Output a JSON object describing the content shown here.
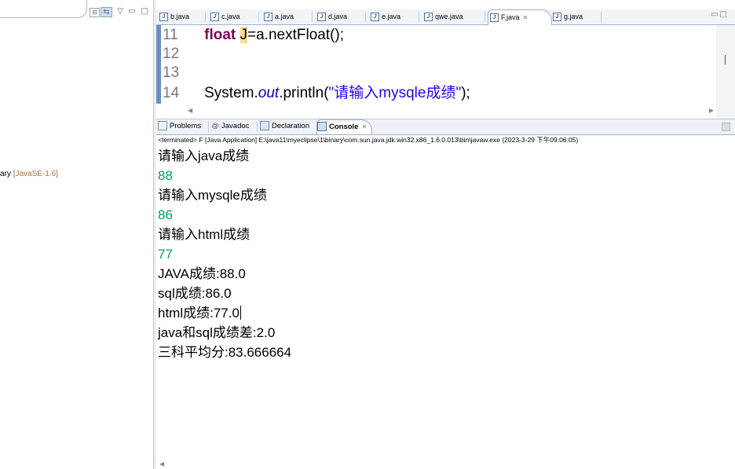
{
  "explorer": {
    "item_text": "ary",
    "item_jre": "[JavaSE-1.6]",
    "toolbar": [
      "collapse-all",
      "link-with-editor",
      "view-menu",
      "minimize",
      "maximize"
    ]
  },
  "editor": {
    "tabs": [
      {
        "label": "b.java"
      },
      {
        "label": "c.java"
      },
      {
        "label": "a.java"
      },
      {
        "label": "d.java"
      },
      {
        "label": "e.java"
      },
      {
        "label": "qwe.java"
      },
      {
        "label": "F.java",
        "active": true
      },
      {
        "label": "g.java"
      }
    ],
    "lines": [
      {
        "num": "11",
        "kw": "float",
        "var": "J",
        "rest": "=a.nextFloat();"
      },
      {
        "num": "12"
      },
      {
        "num": "13"
      },
      {
        "num": "14",
        "prefix": "System.",
        "field": "out",
        "method": ".println(",
        "string": "\"请输入mysqle成绩\"",
        "suffix": ");"
      }
    ]
  },
  "console": {
    "tabs": [
      {
        "label": "Problems",
        "icon": "problems-icon"
      },
      {
        "label": "Javadoc",
        "icon": "at-icon"
      },
      {
        "label": "Declaration",
        "icon": "declaration-icon"
      },
      {
        "label": "Console",
        "icon": "console-icon",
        "active": true
      }
    ],
    "status": "<terminated> F [Java Application] E:\\java11\\myeclipse\\1\\binary\\com.sun.java.jdk.win32.x86_1.6.0.013\\bin\\javaw.exe (2023-3-29 下午09:06:05)",
    "output": [
      {
        "text": "请输入java成绩",
        "type": "out"
      },
      {
        "text": "88",
        "type": "in"
      },
      {
        "text": "请输入mysqle成绩",
        "type": "out"
      },
      {
        "text": "86",
        "type": "in"
      },
      {
        "text": "请输入html成绩",
        "type": "out"
      },
      {
        "text": "77",
        "type": "in"
      },
      {
        "text": "JAVA成绩:88.0",
        "type": "out"
      },
      {
        "text": "sql成绩:86.0",
        "type": "out"
      },
      {
        "text": "html成绩:77.0",
        "type": "out"
      },
      {
        "text": "java和sql成绩差:2.0",
        "type": "out"
      },
      {
        "text": "三科平均分:83.666664",
        "type": "out"
      }
    ]
  },
  "colors": {
    "keyword": "#7f0055",
    "string": "#2a00ff",
    "console_input": "#00a06a",
    "tab_border": "#9fb0c8"
  }
}
